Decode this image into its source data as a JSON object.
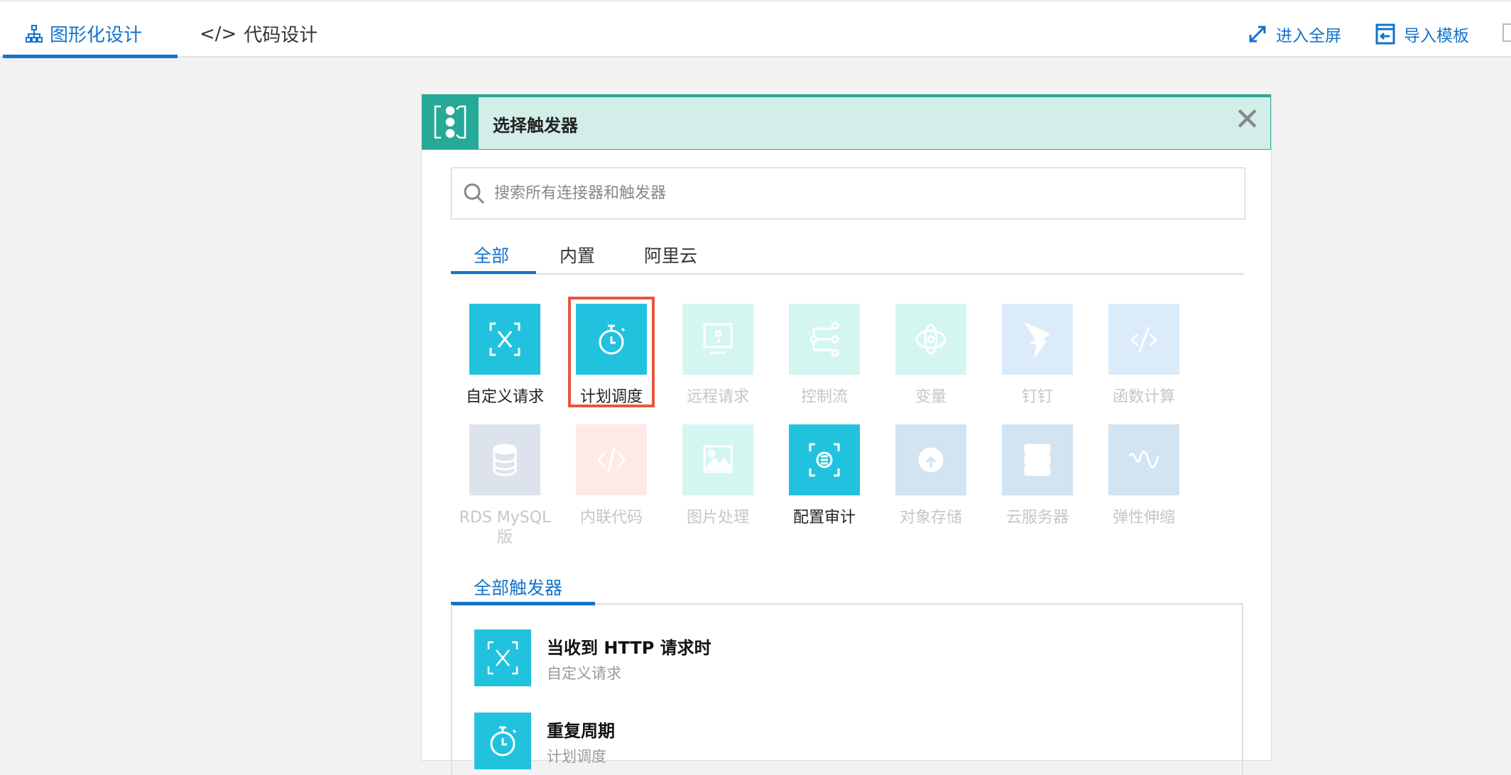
{
  "topbar": {
    "tabs": [
      {
        "label": "图形化设计",
        "icon": "sitemap-icon"
      },
      {
        "label": "代码设计",
        "icon": "code-icon"
      }
    ],
    "fullscreen_label": "进入全屏",
    "import_label": "导入模板"
  },
  "modal": {
    "title": "选择触发器",
    "search_placeholder": "搜索所有连接器和触发器",
    "tabs": [
      "全部",
      "内置",
      "阿里云"
    ],
    "connectors": [
      {
        "label": "自定义请求",
        "color": "#21c2de",
        "enabled": true,
        "icon": "custom-request-icon"
      },
      {
        "label": "计划调度",
        "color": "#21c2de",
        "enabled": true,
        "icon": "stopwatch-icon"
      },
      {
        "label": "远程请求",
        "color": "#d4f6f1",
        "enabled": false,
        "icon": "remote-icon"
      },
      {
        "label": "控制流",
        "color": "#d4f6f1",
        "enabled": false,
        "icon": "flow-icon"
      },
      {
        "label": "变量",
        "color": "#d4f6f1",
        "enabled": false,
        "icon": "variable-icon"
      },
      {
        "label": "钉钉",
        "color": "#dcebfa",
        "enabled": false,
        "icon": "dingtalk-icon"
      },
      {
        "label": "函数计算",
        "color": "#dcebfa",
        "enabled": false,
        "icon": "function-icon"
      },
      {
        "label": "RDS MySQL 版",
        "color": "#dde3ea",
        "enabled": false,
        "icon": "database-icon"
      },
      {
        "label": "内联代码",
        "color": "#fde9e5",
        "enabled": false,
        "icon": "code-icon"
      },
      {
        "label": "图片处理",
        "color": "#d4f6f1",
        "enabled": false,
        "icon": "image-icon"
      },
      {
        "label": "配置审计",
        "color": "#21c2de",
        "enabled": true,
        "icon": "config-audit-icon"
      },
      {
        "label": "对象存储",
        "color": "#d2e3f2",
        "enabled": false,
        "icon": "oss-icon"
      },
      {
        "label": "云服务器",
        "color": "#d2e3f2",
        "enabled": false,
        "icon": "server-icon"
      },
      {
        "label": "弹性伸缩",
        "color": "#d2e3f2",
        "enabled": false,
        "icon": "autoscale-icon"
      }
    ],
    "section_title": "全部触发器",
    "triggers": [
      {
        "title": "当收到 HTTP 请求时",
        "subtitle": "自定义请求"
      },
      {
        "title": "重复周期",
        "subtitle": "计划调度"
      }
    ]
  }
}
